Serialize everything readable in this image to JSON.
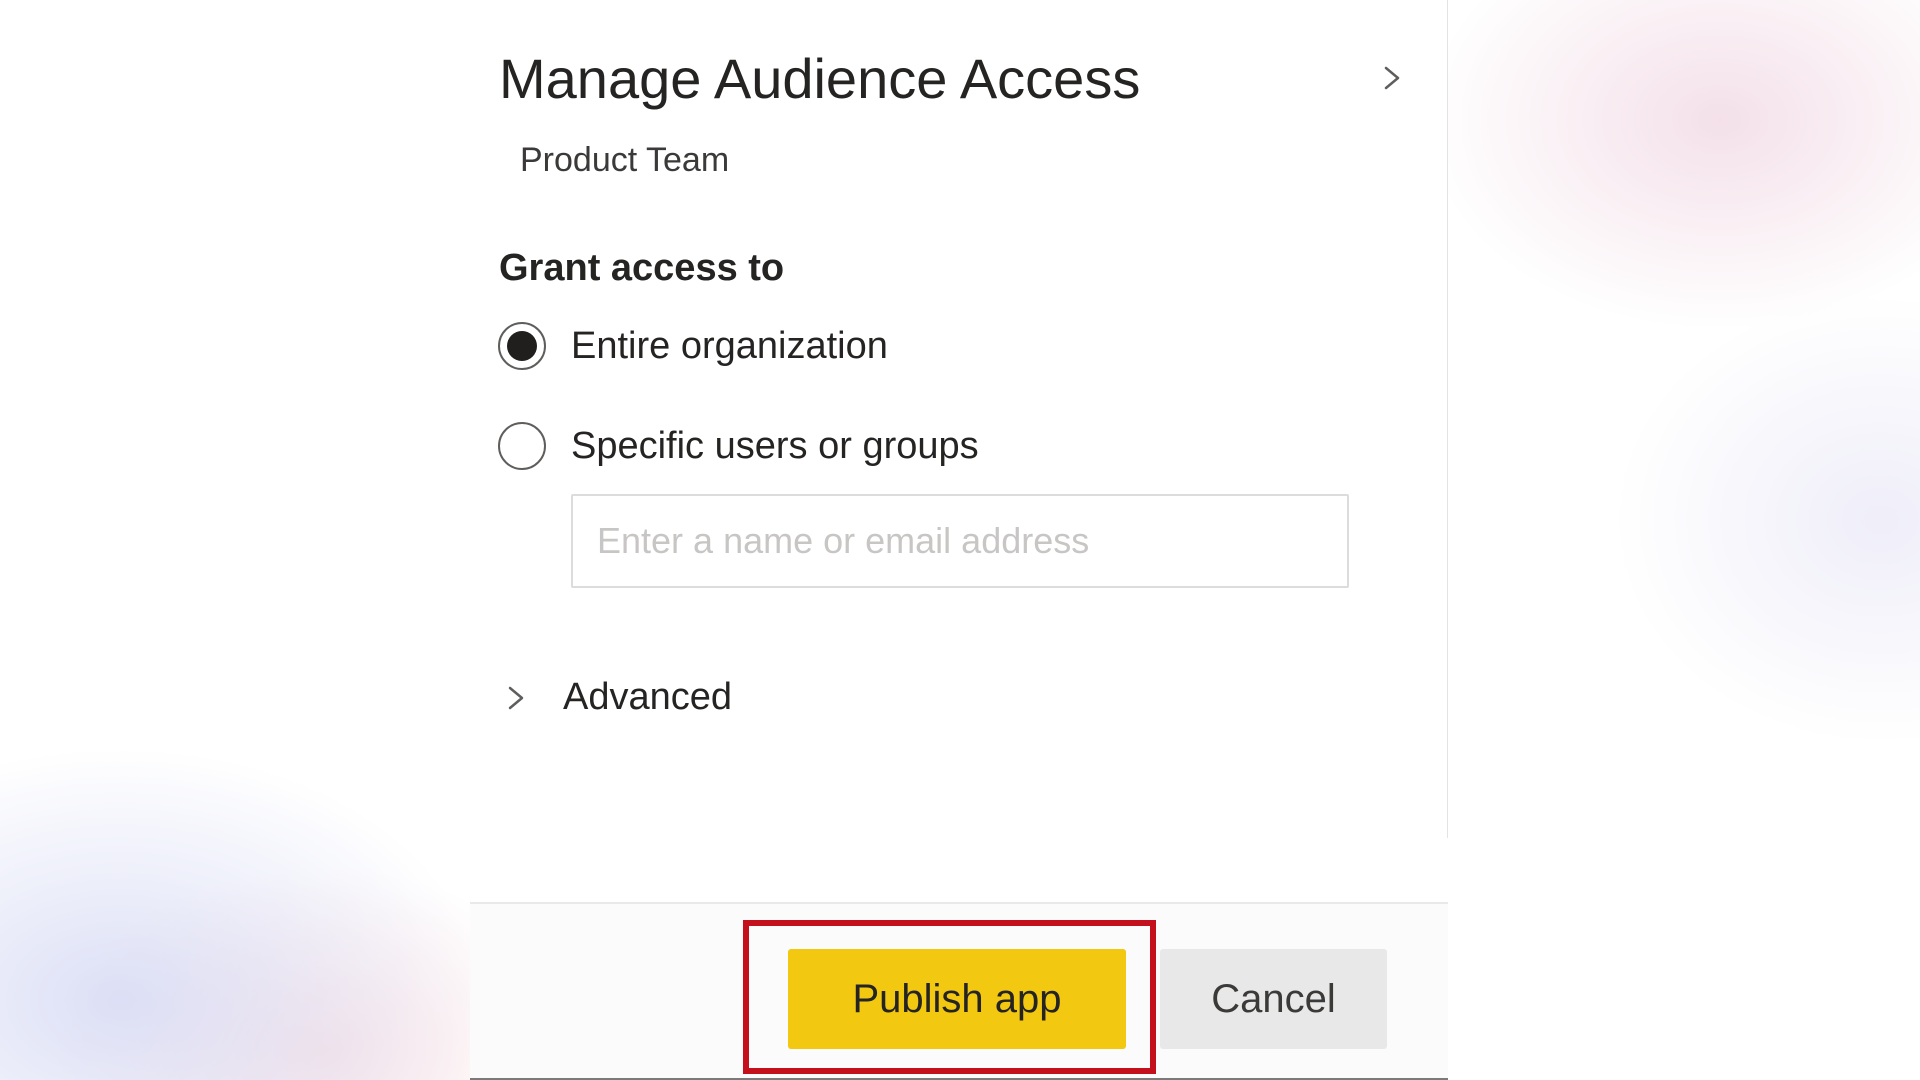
{
  "panel": {
    "title": "Manage Audience Access",
    "subtitle": "Product Team",
    "header_icon": "chevron-right-icon"
  },
  "grant_access": {
    "label": "Grant access to",
    "options": [
      {
        "label": "Entire organization",
        "selected": true
      },
      {
        "label": "Specific users or groups",
        "selected": false
      }
    ],
    "input": {
      "value": "",
      "placeholder": "Enter a name or email address"
    }
  },
  "advanced": {
    "label": "Advanced",
    "icon": "chevron-right-icon",
    "expanded": false
  },
  "footer": {
    "publish_label": "Publish app",
    "cancel_label": "Cancel"
  },
  "colors": {
    "publish_button": "#f2c811",
    "highlight_outline": "#c4101d",
    "cancel_button": "#e8e8e8",
    "text": "#252423"
  }
}
